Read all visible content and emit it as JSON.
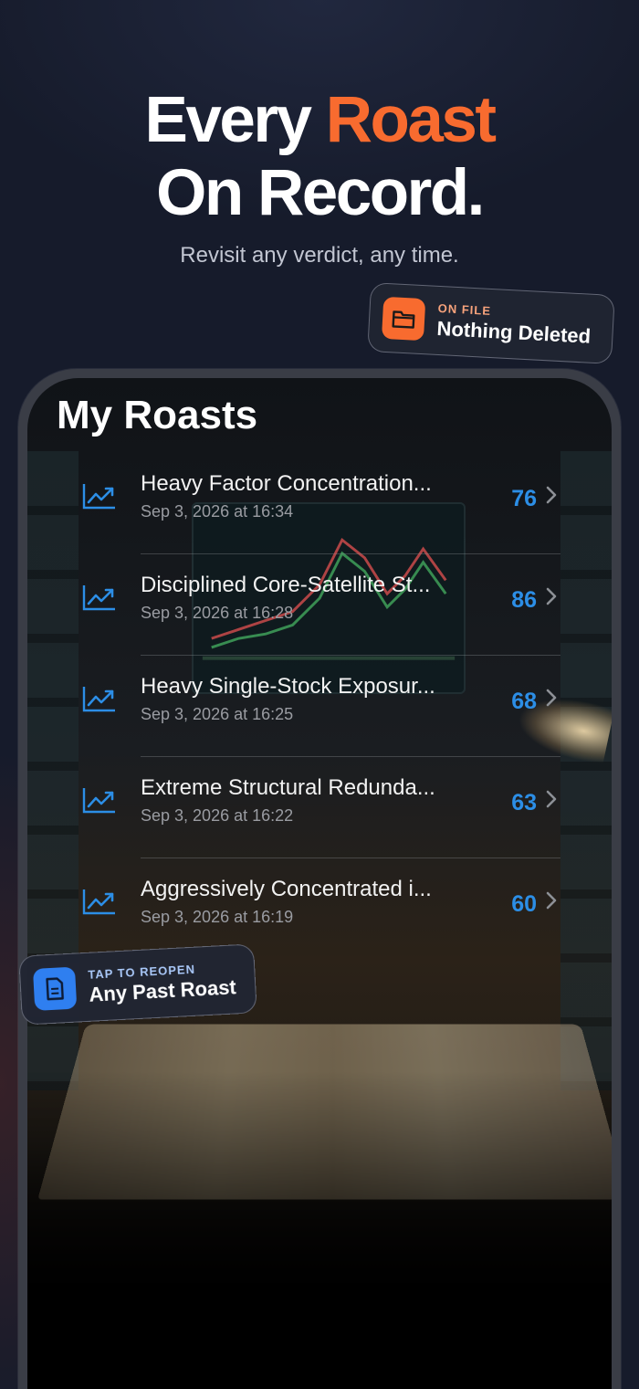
{
  "headline": {
    "line1_a": "Every",
    "line1_accent": "Roast",
    "line2": "On Record."
  },
  "subtitle": "Revisit any verdict, any time.",
  "badges": {
    "file": {
      "kicker": "ON FILE",
      "text": "Nothing Deleted",
      "icon": "folder-icon"
    },
    "reopen": {
      "kicker": "TAP TO REOPEN",
      "text": "Any Past Roast",
      "icon": "document-icon"
    }
  },
  "screen": {
    "title": "My Roasts",
    "roasts": [
      {
        "title": "Heavy Factor Concentration...",
        "date": "Sep 3, 2026 at 16:34",
        "score": "76"
      },
      {
        "title": "Disciplined Core-Satellite St...",
        "date": "Sep 3, 2026 at 16:28",
        "score": "86"
      },
      {
        "title": "Heavy Single-Stock Exposur...",
        "date": "Sep 3, 2026 at 16:25",
        "score": "68"
      },
      {
        "title": "Extreme Structural Redunda...",
        "date": "Sep 3, 2026 at 16:22",
        "score": "63"
      },
      {
        "title": "Aggressively Concentrated i...",
        "date": "Sep 3, 2026 at 16:19",
        "score": "60"
      }
    ]
  },
  "colors": {
    "accent": "#f86b2f",
    "score": "#2c8ee6",
    "background": "#161b2b"
  }
}
